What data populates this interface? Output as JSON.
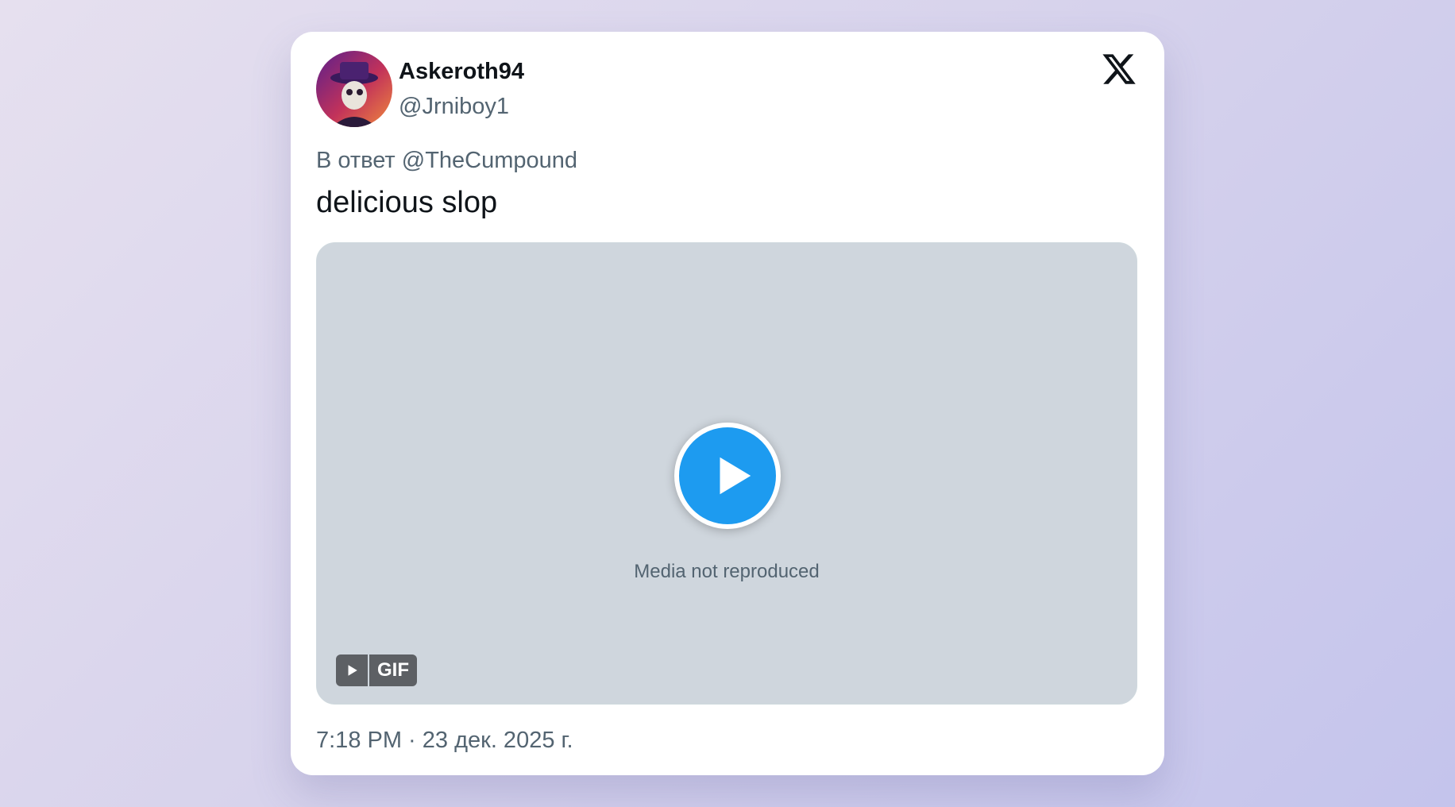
{
  "tweet": {
    "display_name": "Askeroth94",
    "handle": "@Jrniboy1",
    "reply_to": "В ответ @TheCumpound",
    "text": "delicious slop",
    "timestamp": "7:18 PM · 23 дек. 2025 г.",
    "media": {
      "type": "gif",
      "badge_label": "GIF",
      "placeholder_note": "Media not reproduced"
    }
  },
  "icons": {
    "logo": "x-logo-icon",
    "avatar": "avatar-image",
    "play": "play-icon"
  },
  "colors": {
    "accent": "#1d9bf0",
    "text_primary": "#0f1419",
    "text_secondary": "#536471",
    "card_background": "#ffffff"
  }
}
